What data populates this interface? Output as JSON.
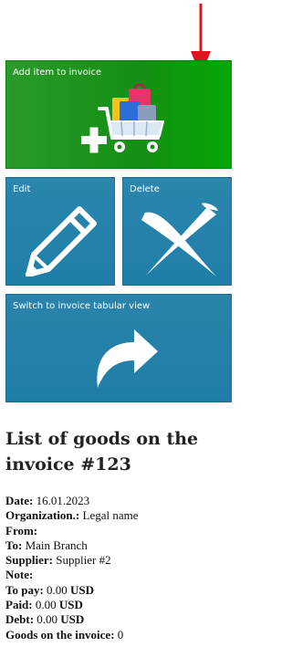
{
  "tiles": {
    "add_item": {
      "label": "Add item to invoice",
      "icon": "shopping-cart-add-icon",
      "color": "#109010"
    },
    "edit": {
      "label": "Edit",
      "icon": "pencil-icon",
      "color": "#2382ab"
    },
    "delete": {
      "label": "Delete",
      "icon": "close-x-icon",
      "color": "#2382ab"
    },
    "switch_view": {
      "label": "Switch to invoice tabular view",
      "icon": "curved-arrow-icon",
      "color": "#2382ab"
    }
  },
  "hint_arrow": {
    "icon": "red-down-arrow-icon",
    "color": "#e0141e"
  },
  "title": "List of goods on the invoice #123",
  "details": {
    "date": {
      "label": "Date:",
      "value": " 16.01.2023"
    },
    "organization": {
      "label": "Organization.:",
      "value": " Legal name"
    },
    "from": {
      "label": "From:",
      "value": ""
    },
    "to": {
      "label": "To:",
      "value": " Main Branch"
    },
    "supplier": {
      "label": "Supplier:",
      "value": " Supplier #2"
    },
    "note": {
      "label": "Note:",
      "value": ""
    },
    "to_pay": {
      "label": "To pay:",
      "value": " 0.00 ",
      "currency": "USD"
    },
    "paid": {
      "label": "Paid:",
      "value": " 0.00 ",
      "currency": "USD"
    },
    "debt": {
      "label": "Debt:",
      "value": " 0.00 ",
      "currency": "USD"
    },
    "goods_count": {
      "label": "Goods on the invoice:",
      "value": " 0"
    }
  }
}
